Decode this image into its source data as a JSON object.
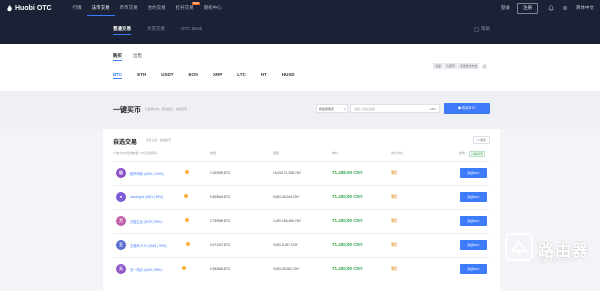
{
  "brand": {
    "name": "Huobi",
    "otc": "OTC"
  },
  "topnav": [
    "行情",
    "法币交易",
    "币币交易",
    "合约交易",
    "杠杆交易",
    "期权中心"
  ],
  "topnav_new_badge": "NEW",
  "top_right": {
    "login": "登录",
    "register": "注册",
    "lang": "简体中文"
  },
  "trade_tabs": [
    "普通交易",
    "大宗交易",
    "OTC Desk"
  ],
  "help": "帮助",
  "buy_sell": [
    "购买",
    "出售"
  ],
  "coins": [
    "BTC",
    "ETH",
    "USDT",
    "EOS",
    "XRP",
    "LTC",
    "HT",
    "HUSD"
  ],
  "filters": [
    "全部",
    "人民币",
    "全部支付方式"
  ],
  "quick_buy": {
    "title": "一键买币",
    "desc": "以最优价格，自动撮合，快捷买币",
    "select": "按金额购买",
    "placeholder": "请输入购买金额",
    "unit": "CNY",
    "button": "购买BTC"
  },
  "table": {
    "title": "自选交易",
    "subtitle": "商家认证 · 快速放币",
    "refresh": "刷新",
    "headers": {
      "merchant": "广告方(30日成单量 | 30日完成率)",
      "amount": "数量",
      "limit": "限额",
      "price": "单价",
      "payment": "支付方式",
      "action": "操作",
      "filter": "只看商家"
    },
    "rows": [
      {
        "avatar": "极",
        "name": "极币商家 (4330 | 100%)",
        "amount": "1.000993 BTC",
        "limit": "15,000-71,298 CNY",
        "price": "71,298.00 CNY",
        "pay": "银行",
        "button": "购买BTC"
      },
      {
        "avatar": "d",
        "name": "douang-xi (4001 | 99%)",
        "amount": "0.505544 BTC",
        "limit": "5,000-36,044 CNY",
        "price": "71,300.00 CNY",
        "pay": "银行",
        "button": "购买BTC"
      },
      {
        "avatar": "万",
        "name": "万胜生活 (3019 | 99%)",
        "amount": "2.755969 BTC",
        "limit": "1,000-196,496 CNY",
        "price": "71,300.00 CNY",
        "pay": "银行",
        "button": "购买BTC"
      },
      {
        "avatar": "王",
        "name": "王城商-OTC (3662 | 99%)",
        "amount": "0.071407 BTC",
        "limit": "3,000-5,097 CNY",
        "price": "71,300.00 CNY",
        "pay": "银行",
        "button": "购买BTC"
      },
      {
        "avatar": "天",
        "name": "天一商店 (1633 | 98%)",
        "amount": "0.393546 BTC",
        "limit": "3,000-28,062 CNY",
        "price": "71,300.00 CNY",
        "pay": "银行",
        "button": "购买BTC"
      }
    ]
  },
  "watermark": {
    "text": "路由器",
    "url": "luyouqi.com"
  },
  "colors": {
    "nav_bg": "#1b2235",
    "accent": "#3e7bfa",
    "price_green": "#2fa24c",
    "avatar": [
      "#8a4fc7",
      "#7d5bd6",
      "#c05fa8",
      "#5a6fcf",
      "#8e57c9"
    ]
  }
}
